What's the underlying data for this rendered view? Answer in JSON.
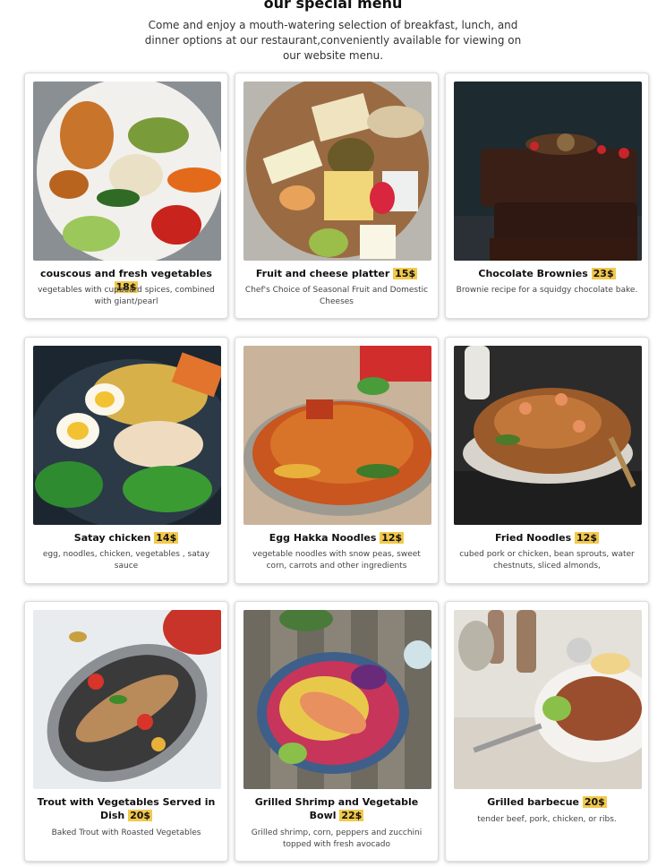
{
  "header": {
    "title": "our special menu",
    "intro": "Come and enjoy a mouth-watering selection of breakfast, lunch, and dinner options at our restaurant,conveniently available for viewing on our website menu."
  },
  "menu": [
    {
      "name": "couscous and fresh vegetables",
      "price": "18$",
      "desc": "vegetables with cupboard spices, combined with giant/pearl",
      "photo": "vegetable-plate-photo"
    },
    {
      "name": "Fruit and cheese platter",
      "price": "15$",
      "desc": "Chef's Choice of Seasonal Fruit and Domestic Cheeses",
      "photo": "cheese-platter-photo"
    },
    {
      "name": "Chocolate Brownies",
      "price": "23$",
      "desc": "Brownie recipe for a squidgy chocolate bake.",
      "photo": "brownies-photo"
    },
    {
      "name": "Satay chicken",
      "price": "14$",
      "desc": "egg, noodles, chicken, vegetables , satay sauce",
      "photo": "satay-chicken-photo"
    },
    {
      "name": "Egg Hakka Noodles",
      "price": "12$",
      "desc": "vegetable noodles with snow peas, sweet corn, carrots and other ingredients",
      "photo": "hakka-noodles-photo"
    },
    {
      "name": "Fried Noodles",
      "price": "12$",
      "desc": "cubed pork or chicken, bean sprouts, water chestnuts, sliced almonds,",
      "photo": "fried-noodles-photo"
    },
    {
      "name": "Trout with Vegetables Served in Dish",
      "price": "20$",
      "desc": "Baked Trout with Roasted Vegetables",
      "photo": "trout-dish-photo"
    },
    {
      "name": "Grilled Shrimp and Vegetable Bowl",
      "price": "22$",
      "desc": "Grilled shrimp, corn, peppers and zucchini topped with fresh avocado",
      "photo": "shrimp-bowl-photo"
    },
    {
      "name": "Grilled barbecue",
      "price": "20$",
      "desc": "tender beef, pork, chicken, or ribs.",
      "photo": "barbecue-photo"
    }
  ]
}
